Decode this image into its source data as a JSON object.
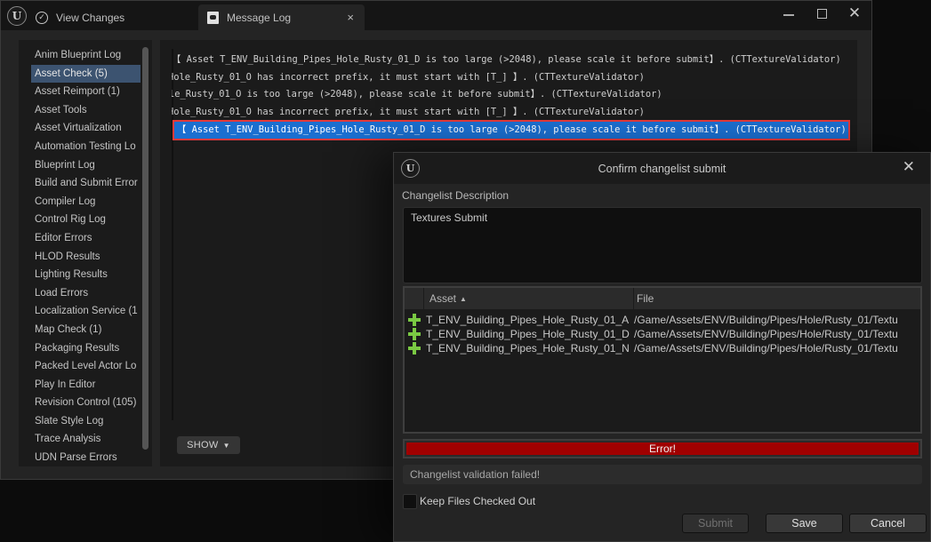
{
  "window": {
    "tabs": [
      {
        "label": "View Changes",
        "icon": "check-circle-icon",
        "active": false
      },
      {
        "label": "Message Log",
        "icon": "message-log-icon",
        "active": true
      }
    ],
    "tab_close_glyph": "×",
    "controls": {
      "minimize": "minimize",
      "maximize": "maximize",
      "close": "✕"
    }
  },
  "sidebar": {
    "selected_index": 1,
    "items": [
      "Anim Blueprint Log",
      "Asset Check (5)",
      "Asset Reimport (1)",
      "Asset Tools",
      "Asset Virtualization",
      "Automation Testing Lo",
      "Blueprint Log",
      "Build and Submit Error",
      "Compiler Log",
      "Control Rig Log",
      "Editor Errors",
      "HLOD Results",
      "Lighting Results",
      "Load Errors",
      "Localization Service (1",
      "Map Check (1)",
      "Packaging Results",
      "Packed Level Actor Lo",
      "Play In Editor",
      "Revision Control (105)",
      "Slate Style Log",
      "Trace Analysis",
      "UDN Parse Errors"
    ]
  },
  "log": {
    "lines": [
      "【 Asset T_ENV_Building_Pipes_Hole_Rusty_01_D is too large (>2048), please scale it before submit】. (CTTextureValidator)",
      "Hole_Rusty_01_O has incorrect prefix, it must start with [T_] 】. (CTTextureValidator)",
      "le_Rusty_01_O is too large (>2048), please scale it before submit】. (CTTextureValidator)",
      "Hole_Rusty_01_O has incorrect prefix, it must start with [T_] 】. (CTTextureValidator)",
      "【 Asset T_ENV_Building_Pipes_Hole_Rusty_01_D is too large (>2048), please scale it before submit】. (CTTextureValidator)"
    ],
    "selected_index": 4,
    "show_button": "SHOW",
    "show_chevron": "⌄"
  },
  "dialog": {
    "title": "Confirm changelist submit",
    "close_glyph": "✕",
    "description_label": "Changelist Description",
    "description_value": "Textures Submit",
    "table": {
      "columns": [
        "Asset",
        "File"
      ],
      "sort_indicator": "▲",
      "rows": [
        {
          "status_icon": "add-icon",
          "asset": "T_ENV_Building_Pipes_Hole_Rusty_01_A",
          "file": "/Game/Assets/ENV/Building/Pipes/Hole/Rusty_01/Textu"
        },
        {
          "status_icon": "add-icon",
          "asset": "T_ENV_Building_Pipes_Hole_Rusty_01_D",
          "file": "/Game/Assets/ENV/Building/Pipes/Hole/Rusty_01/Textu"
        },
        {
          "status_icon": "add-icon",
          "asset": "T_ENV_Building_Pipes_Hole_Rusty_01_N",
          "file": "/Game/Assets/ENV/Building/Pipes/Hole/Rusty_01/Textu"
        }
      ]
    },
    "error_banner": "Error!",
    "error_color": "#a00000",
    "status_message": "Changelist validation failed!",
    "keep_checked_out_label": "Keep Files Checked Out",
    "keep_checked_out": false,
    "buttons": {
      "submit": "Submit",
      "save": "Save",
      "cancel": "Cancel"
    },
    "submit_enabled": false
  },
  "colors": {
    "selection": "#3c5370",
    "log_selection": "#1b6fd0",
    "log_highlight_border": "#e23a3a",
    "add_icon": "#7ac943"
  }
}
